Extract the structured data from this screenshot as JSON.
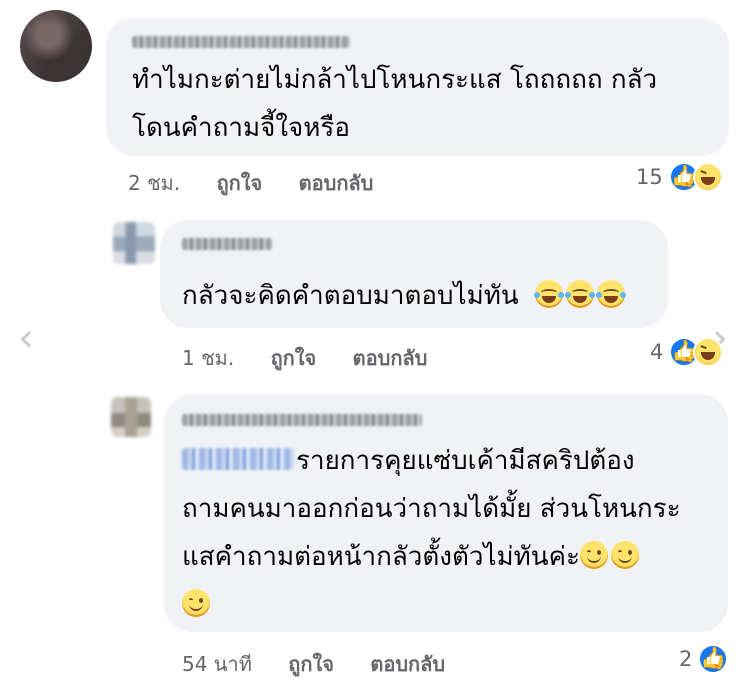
{
  "comments": [
    {
      "text_line1": "ทำไมกะต่ายไม่กล้าไปโหนกระแส โถถถถถ กลัว",
      "text_line2": "โดนคำถามจี้ใจหรือ",
      "time": "2 ชม.",
      "like_label": "ถูกใจ",
      "reply_label": "ตอบกลับ",
      "reaction_count": "15",
      "reactions": [
        "like",
        "haha"
      ]
    },
    {
      "text_line1": "กลัวจะคิดคำตอบมาตอบไม่ทัน",
      "emojis": [
        "laughing-tears",
        "laughing-tears",
        "laughing-tears"
      ],
      "time": "1 ชม.",
      "like_label": "ถูกใจ",
      "reply_label": "ตอบกลับ",
      "reaction_count": "4",
      "reactions": [
        "like",
        "haha"
      ]
    },
    {
      "text_line1": "รายการคุยแซ่บเค้ามีสคริปต้อง",
      "text_line2": "ถามคนมาออกก่อนว่าถามได้มั้ย ส่วนโหนกระ",
      "text_line3": "แสคำถามต่อหน้ากลัวตั้งตัวไม่ทันค่ะ",
      "emojis": [
        "smiling-face",
        "smiling-face",
        "smiling-face"
      ],
      "time": "54 นาที",
      "like_label": "ถูกใจ",
      "reply_label": "ตอบกลับ",
      "reaction_count": "2",
      "reactions": [
        "like"
      ]
    }
  ],
  "nav": {
    "prev_icon": "‹",
    "next_icon": "›"
  },
  "colors": {
    "bubble": "#f0f2f5",
    "meta": "#65676b",
    "like": "#1877f2"
  }
}
